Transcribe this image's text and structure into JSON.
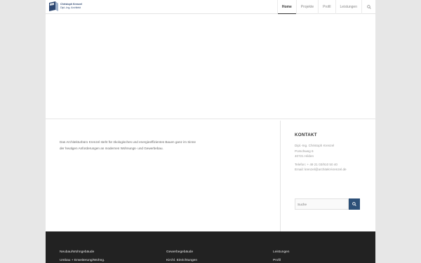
{
  "header": {
    "logo": {
      "line1": "Christoph Krenzel",
      "line2": "Dipl.-Ing. Architekt"
    },
    "nav": [
      {
        "label": "Home",
        "active": true
      },
      {
        "label": "Projekte",
        "active": false
      },
      {
        "label": "Profil",
        "active": false
      },
      {
        "label": "Leistungen",
        "active": false
      }
    ],
    "search_icon": "search-icon"
  },
  "about": {
    "text": "Das Architekturbüro Krenzel steht für ökologisches und energieeffizientes Bauen ganz im Sinne der heutigen Anforderungen an modernen Wohnungs- und Gewerbebau."
  },
  "contact": {
    "title": "KONTAKT",
    "name": "Dipl.-Ing. Christoph Krenzel",
    "street": "Porschweg 6",
    "city": "40721 Hilden",
    "phone": "Telefon: + 49 21 03/910 50 40",
    "email": "Email: krenzel@architekt-krenzel.de"
  },
  "search": {
    "placeholder": "Suche"
  },
  "footer": {
    "col1": [
      "Neubau/Wohngebäude",
      "Umbau + Erweiterung/Wohng."
    ],
    "col2": [
      "Gewerbegebäude",
      "Kirchl. Einrichtungen"
    ],
    "col3": [
      "Leistungen",
      "Profil"
    ]
  },
  "colors": {
    "accent": "#2d5078",
    "footer_bg": "#222222",
    "page_bg": "#e7e7e7"
  }
}
